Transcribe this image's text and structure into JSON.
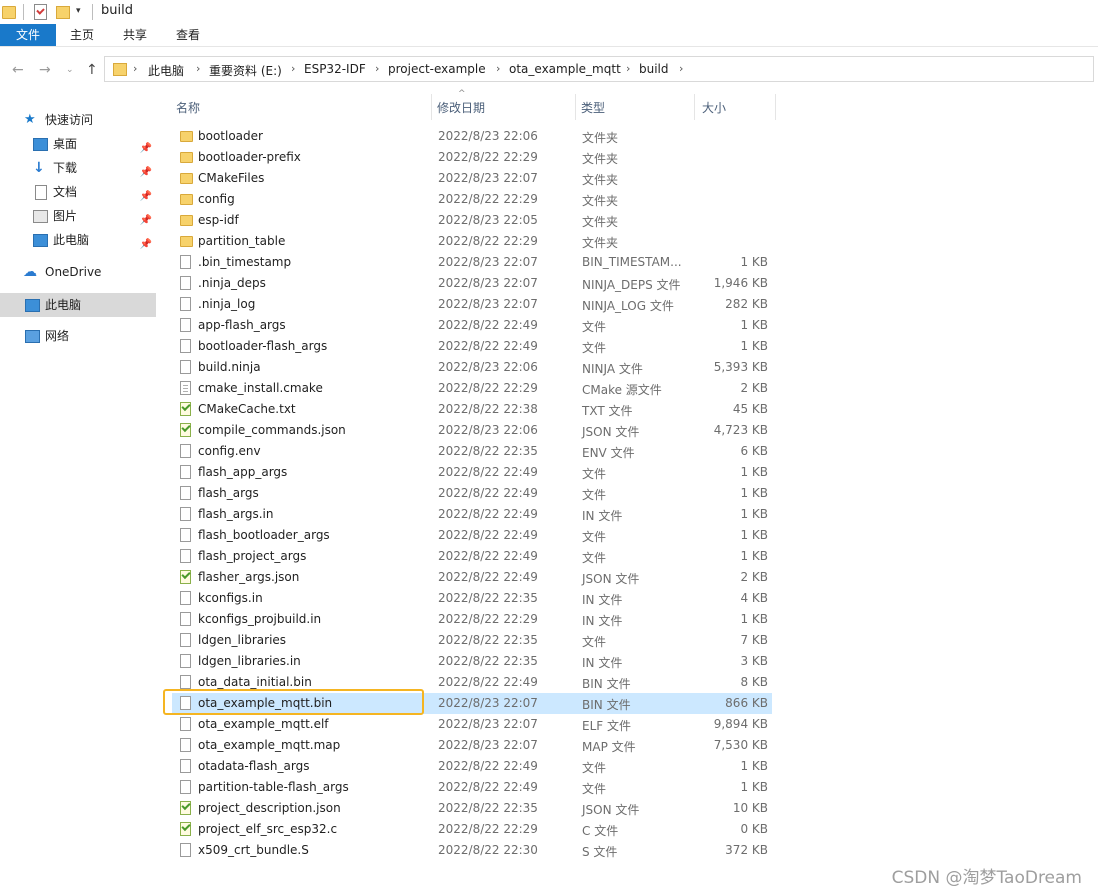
{
  "window": {
    "title": "build"
  },
  "ribbon": {
    "tabs": [
      "文件",
      "主页",
      "共享",
      "查看"
    ]
  },
  "breadcrumb": [
    "此电脑",
    "重要资料 (E:)",
    "ESP32-IDF",
    "project-example",
    "ota_example_mqtt",
    "build"
  ],
  "navpane": {
    "items": [
      {
        "label": "快速访问",
        "icon": "star-icon"
      },
      {
        "label": "桌面",
        "icon": "desktop-icon",
        "pinned": true
      },
      {
        "label": "下载",
        "icon": "download-icon",
        "pinned": true
      },
      {
        "label": "文档",
        "icon": "document-icon",
        "pinned": true
      },
      {
        "label": "图片",
        "icon": "picture-icon",
        "pinned": true
      },
      {
        "label": "此电脑",
        "icon": "computer-icon",
        "pinned": true
      },
      {
        "label": "OneDrive",
        "icon": "cloud-icon"
      },
      {
        "label": "此电脑",
        "icon": "computer-icon",
        "selected": true
      },
      {
        "label": "网络",
        "icon": "network-icon"
      }
    ]
  },
  "columns": {
    "name": "名称",
    "date": "修改日期",
    "type": "类型",
    "size": "大小"
  },
  "files": [
    {
      "name": "bootloader",
      "date": "2022/8/23 22:06",
      "type": "文件夹",
      "size": "",
      "icon": "folder"
    },
    {
      "name": "bootloader-prefix",
      "date": "2022/8/22 22:29",
      "type": "文件夹",
      "size": "",
      "icon": "folder"
    },
    {
      "name": "CMakeFiles",
      "date": "2022/8/23 22:07",
      "type": "文件夹",
      "size": "",
      "icon": "folder"
    },
    {
      "name": "config",
      "date": "2022/8/22 22:29",
      "type": "文件夹",
      "size": "",
      "icon": "folder"
    },
    {
      "name": "esp-idf",
      "date": "2022/8/23 22:05",
      "type": "文件夹",
      "size": "",
      "icon": "folder"
    },
    {
      "name": "partition_table",
      "date": "2022/8/22 22:29",
      "type": "文件夹",
      "size": "",
      "icon": "folder"
    },
    {
      "name": ".bin_timestamp",
      "date": "2022/8/23 22:07",
      "type": "BIN_TIMESTAM...",
      "size": "1 KB",
      "icon": "file"
    },
    {
      "name": ".ninja_deps",
      "date": "2022/8/23 22:07",
      "type": "NINJA_DEPS 文件",
      "size": "1,946 KB",
      "icon": "file"
    },
    {
      "name": ".ninja_log",
      "date": "2022/8/23 22:07",
      "type": "NINJA_LOG 文件",
      "size": "282 KB",
      "icon": "file"
    },
    {
      "name": "app-flash_args",
      "date": "2022/8/22 22:49",
      "type": "文件",
      "size": "1 KB",
      "icon": "file"
    },
    {
      "name": "bootloader-flash_args",
      "date": "2022/8/22 22:49",
      "type": "文件",
      "size": "1 KB",
      "icon": "file"
    },
    {
      "name": "build.ninja",
      "date": "2022/8/23 22:06",
      "type": "NINJA 文件",
      "size": "5,393 KB",
      "icon": "file"
    },
    {
      "name": "cmake_install.cmake",
      "date": "2022/8/22 22:29",
      "type": "CMake 源文件",
      "size": "2 KB",
      "icon": "cfg"
    },
    {
      "name": "CMakeCache.txt",
      "date": "2022/8/22 22:38",
      "type": "TXT 文件",
      "size": "45 KB",
      "icon": "note"
    },
    {
      "name": "compile_commands.json",
      "date": "2022/8/23 22:06",
      "type": "JSON 文件",
      "size": "4,723 KB",
      "icon": "note"
    },
    {
      "name": "config.env",
      "date": "2022/8/22 22:35",
      "type": "ENV 文件",
      "size": "6 KB",
      "icon": "file"
    },
    {
      "name": "flash_app_args",
      "date": "2022/8/22 22:49",
      "type": "文件",
      "size": "1 KB",
      "icon": "file"
    },
    {
      "name": "flash_args",
      "date": "2022/8/22 22:49",
      "type": "文件",
      "size": "1 KB",
      "icon": "file"
    },
    {
      "name": "flash_args.in",
      "date": "2022/8/22 22:49",
      "type": "IN 文件",
      "size": "1 KB",
      "icon": "file"
    },
    {
      "name": "flash_bootloader_args",
      "date": "2022/8/22 22:49",
      "type": "文件",
      "size": "1 KB",
      "icon": "file"
    },
    {
      "name": "flash_project_args",
      "date": "2022/8/22 22:49",
      "type": "文件",
      "size": "1 KB",
      "icon": "file"
    },
    {
      "name": "flasher_args.json",
      "date": "2022/8/22 22:49",
      "type": "JSON 文件",
      "size": "2 KB",
      "icon": "note"
    },
    {
      "name": "kconfigs.in",
      "date": "2022/8/22 22:35",
      "type": "IN 文件",
      "size": "4 KB",
      "icon": "file"
    },
    {
      "name": "kconfigs_projbuild.in",
      "date": "2022/8/22 22:29",
      "type": "IN 文件",
      "size": "1 KB",
      "icon": "file"
    },
    {
      "name": "ldgen_libraries",
      "date": "2022/8/22 22:35",
      "type": "文件",
      "size": "7 KB",
      "icon": "file"
    },
    {
      "name": "ldgen_libraries.in",
      "date": "2022/8/22 22:35",
      "type": "IN 文件",
      "size": "3 KB",
      "icon": "file"
    },
    {
      "name": "ota_data_initial.bin",
      "date": "2022/8/22 22:49",
      "type": "BIN 文件",
      "size": "8 KB",
      "icon": "file"
    },
    {
      "name": "ota_example_mqtt.bin",
      "date": "2022/8/23 22:07",
      "type": "BIN 文件",
      "size": "866 KB",
      "icon": "file",
      "selected": true
    },
    {
      "name": "ota_example_mqtt.elf",
      "date": "2022/8/23 22:07",
      "type": "ELF 文件",
      "size": "9,894 KB",
      "icon": "file"
    },
    {
      "name": "ota_example_mqtt.map",
      "date": "2022/8/23 22:07",
      "type": "MAP 文件",
      "size": "7,530 KB",
      "icon": "file"
    },
    {
      "name": "otadata-flash_args",
      "date": "2022/8/22 22:49",
      "type": "文件",
      "size": "1 KB",
      "icon": "file"
    },
    {
      "name": "partition-table-flash_args",
      "date": "2022/8/22 22:49",
      "type": "文件",
      "size": "1 KB",
      "icon": "file"
    },
    {
      "name": "project_description.json",
      "date": "2022/8/22 22:35",
      "type": "JSON 文件",
      "size": "10 KB",
      "icon": "note"
    },
    {
      "name": "project_elf_src_esp32.c",
      "date": "2022/8/22 22:29",
      "type": "C 文件",
      "size": "0 KB",
      "icon": "note"
    },
    {
      "name": "x509_crt_bundle.S",
      "date": "2022/8/22 22:30",
      "type": "S 文件",
      "size": "372 KB",
      "icon": "file"
    }
  ],
  "highlight_color": "#f5b522",
  "selection_color": "#cce8ff",
  "accent_color": "#1979ca",
  "watermark": "CSDN @淘梦TaoDream"
}
